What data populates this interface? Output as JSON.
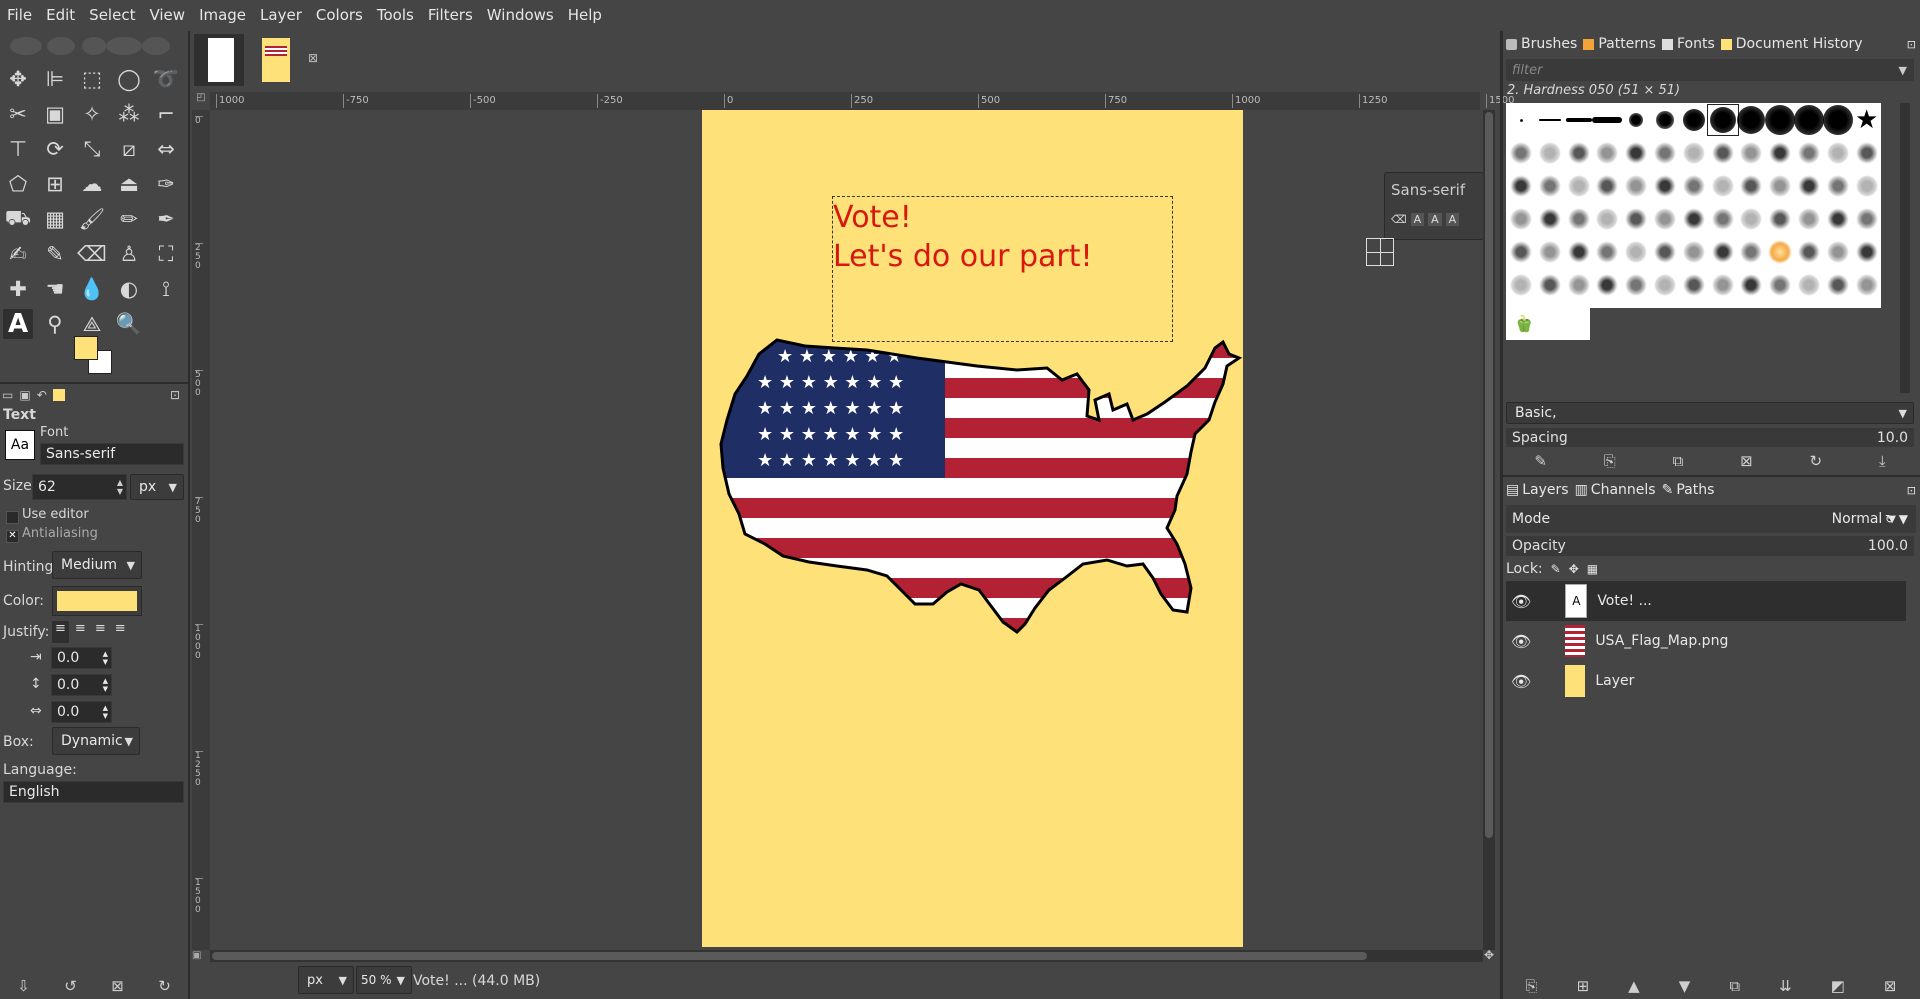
{
  "menu": [
    "File",
    "Edit",
    "Select",
    "View",
    "Image",
    "Layer",
    "Colors",
    "Tools",
    "Filters",
    "Windows",
    "Help"
  ],
  "tool_options": {
    "section_title": "Text",
    "font_label": "Font",
    "font_value": "Sans-serif",
    "font_icon_text": "Aa",
    "size_label": "Size:",
    "size_value": "62",
    "size_unit": "px",
    "use_editor_label": "Use editor",
    "antialiasing_label": "Antialiasing",
    "use_editor_checked": false,
    "antialiasing_checked": true,
    "hinting_label": "Hinting:",
    "hinting_value": "Medium",
    "color_label": "Color:",
    "color_value": "#ffe17a",
    "justify_label": "Justify:",
    "indent_value": "0.0",
    "line_spacing_value": "0.0",
    "letter_spacing_value": "0.0",
    "box_label": "Box:",
    "box_value": "Dynamic",
    "language_label": "Language:",
    "language_value": "English"
  },
  "colors": {
    "fg": "#ffe17a",
    "bg": "#ffffff",
    "poster": "#ffe17a",
    "text_red": "#d7180f"
  },
  "canvas": {
    "ruler_labels": [
      "1000",
      "-750",
      "-500",
      "-250",
      "0",
      "250",
      "500",
      "750",
      "1000",
      "1250",
      "1500"
    ],
    "vruler_labels": [
      "0",
      "250",
      "500",
      "750",
      "1000",
      "1250",
      "1500"
    ],
    "text_line1": "Vote!",
    "text_line2": "Let's do our part!",
    "on_canvas_font": "Sans-serif"
  },
  "status": {
    "unit": "px",
    "zoom": "50 %",
    "message": "Vote! ... (44.0 MB)"
  },
  "brushes_panel": {
    "tabs": [
      "Brushes",
      "Patterns",
      "Fonts",
      "Document History"
    ],
    "filter_placeholder": "filter",
    "selected_brush": "2. Hardness 050 (51 × 51)",
    "preset": "Basic,",
    "spacing_label": "Spacing",
    "spacing_value": "10.0"
  },
  "layers_panel": {
    "tabs": [
      "Layers",
      "Channels",
      "Paths"
    ],
    "mode_label": "Mode",
    "mode_value": "Normal",
    "opacity_label": "Opacity",
    "opacity_value": "100.0",
    "lock_label": "Lock:",
    "layers": [
      {
        "name": "Vote! ...",
        "type": "text-layer",
        "selected": true
      },
      {
        "name": "USA_Flag_Map.png",
        "type": "image-layer",
        "selected": false
      },
      {
        "name": "Layer",
        "type": "fill-layer",
        "selected": false
      }
    ]
  }
}
